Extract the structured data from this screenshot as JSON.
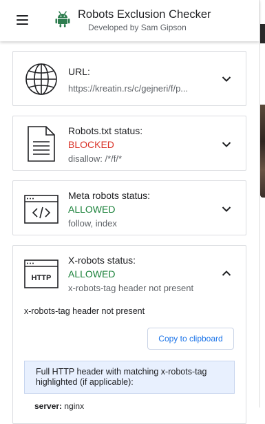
{
  "header": {
    "title": "Robots Exclusion Checker",
    "subtitle": "Developed by Sam Gipson"
  },
  "cards": {
    "url": {
      "label": "URL:",
      "detail": "https://kreatin.rs/c/gejneri/f/p..."
    },
    "robots_txt": {
      "label": "Robots.txt status:",
      "status": "BLOCKED",
      "detail": "disallow: /*/f/*"
    },
    "meta_robots": {
      "label": "Meta robots status:",
      "status": "ALLOWED",
      "detail": "follow, index"
    },
    "x_robots": {
      "label": "X-robots status:",
      "status": "ALLOWED",
      "detail": "x-robots-tag header not present",
      "icon_text": "HTTP",
      "expanded_text": "x-robots-tag header not present",
      "copy_button": "Copy to clipboard",
      "info_box": "Full HTTP header with matching x-robots-tag highlighted (if applicable):",
      "header_key": "server:",
      "header_value": "nginx"
    }
  },
  "colors": {
    "blocked": "#d93025",
    "allowed": "#188038",
    "accent": "#1a73e8"
  },
  "icons": {
    "menu": "hamburger-menu-icon",
    "logo": "android-robot-icon",
    "url": "globe-icon",
    "robots_txt": "document-icon",
    "meta_robots": "code-window-icon",
    "x_robots": "http-window-icon",
    "expand": "chevron-down-icon",
    "collapse": "chevron-up-icon"
  }
}
